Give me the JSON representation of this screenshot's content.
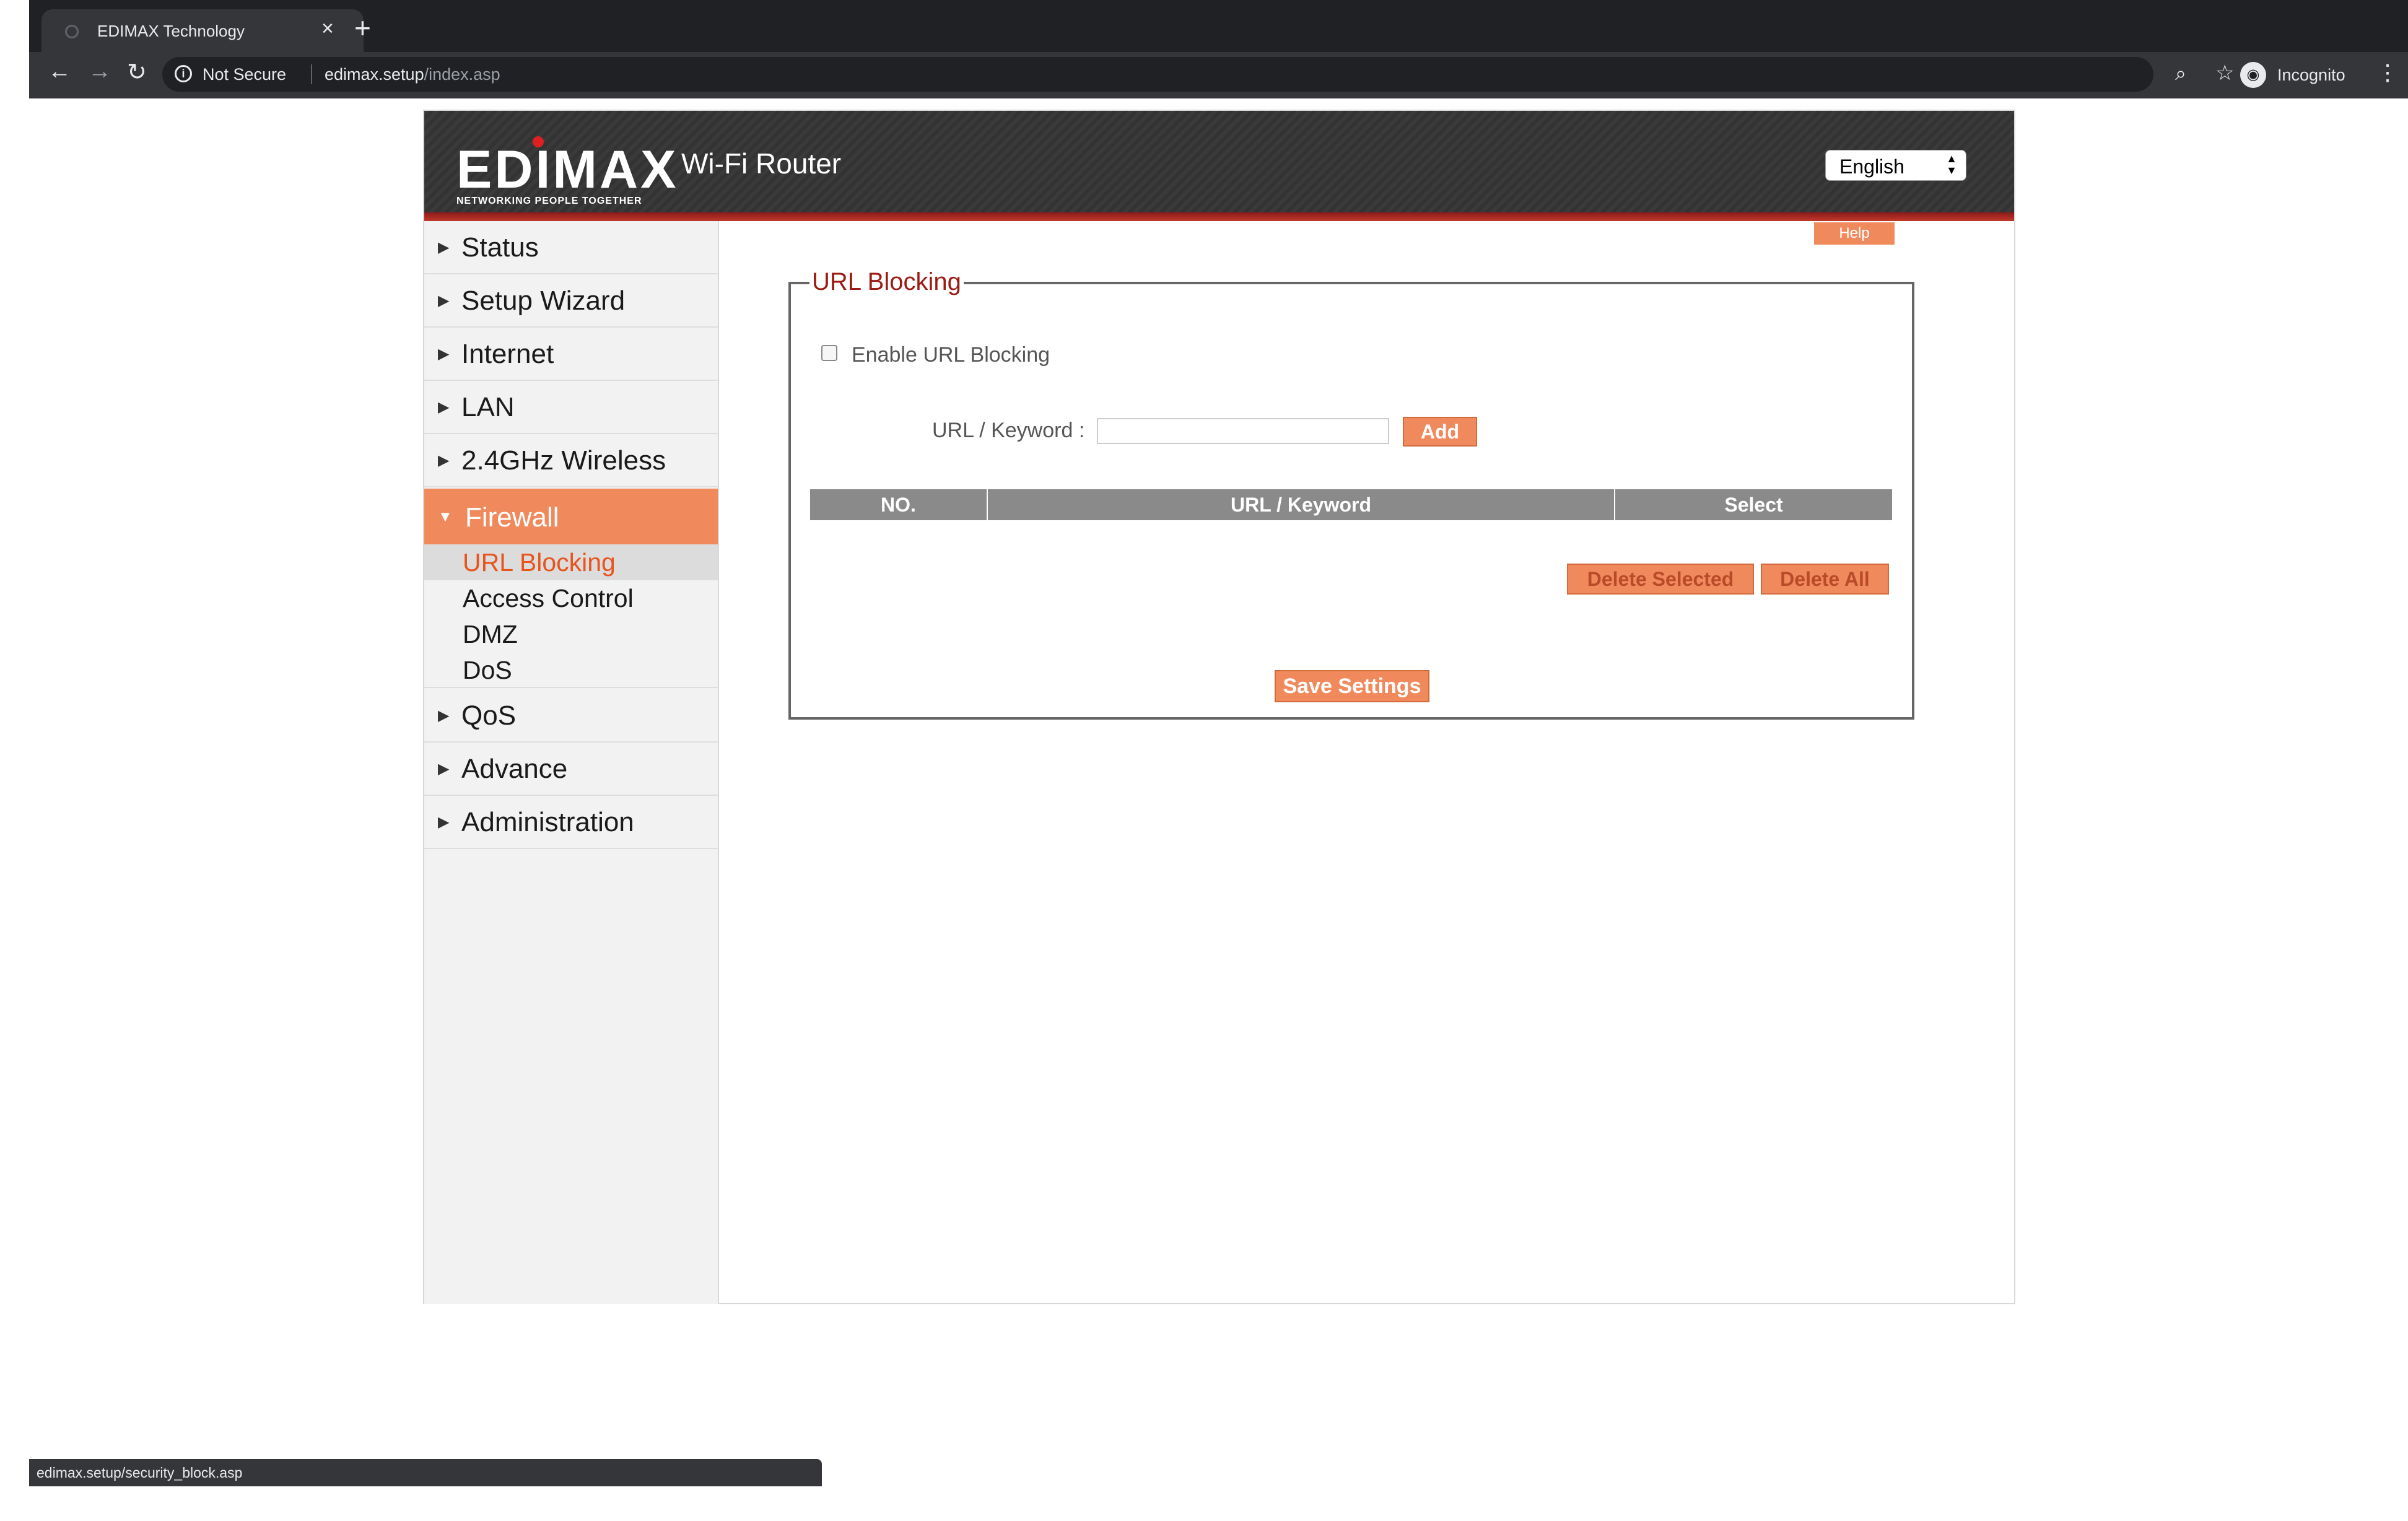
{
  "browser": {
    "tab_title": "EDIMAX Technology",
    "tab_close": "×",
    "new_tab": "+",
    "security_label": "Not Secure",
    "url_host": "edimax.setup",
    "url_path": "/index.asp",
    "profile_label": "Incognito"
  },
  "header": {
    "brand": "EDIMAX",
    "tagline": "NETWORKING PEOPLE TOGETHER",
    "product": "Wi-Fi Router",
    "language": "English"
  },
  "sidebar": {
    "items": [
      {
        "label": "Status"
      },
      {
        "label": "Setup Wizard"
      },
      {
        "label": "Internet"
      },
      {
        "label": "LAN"
      },
      {
        "label": "2.4GHz Wireless"
      },
      {
        "label": "Firewall"
      },
      {
        "label": "QoS"
      },
      {
        "label": "Advance"
      },
      {
        "label": "Administration"
      }
    ],
    "firewall_sub": [
      {
        "label": "URL Blocking"
      },
      {
        "label": "Access Control"
      },
      {
        "label": "DMZ"
      },
      {
        "label": "DoS"
      }
    ]
  },
  "main": {
    "help": "Help",
    "section_title": "URL Blocking",
    "enable_label": "Enable URL Blocking",
    "keyword_label": "URL / Keyword :",
    "keyword_value": "",
    "add_button": "Add",
    "table_headers": [
      "NO.",
      "URL / Keyword",
      "Select"
    ],
    "delete_selected": "Delete Selected",
    "delete_all": "Delete All",
    "save_settings": "Save Settings"
  },
  "status_bar": {
    "url": "edimax.setup/security_block.asp"
  },
  "colors": {
    "accent": "#f08a5d",
    "title_red": "#9b1a12",
    "active_sub": "#e8541c"
  }
}
